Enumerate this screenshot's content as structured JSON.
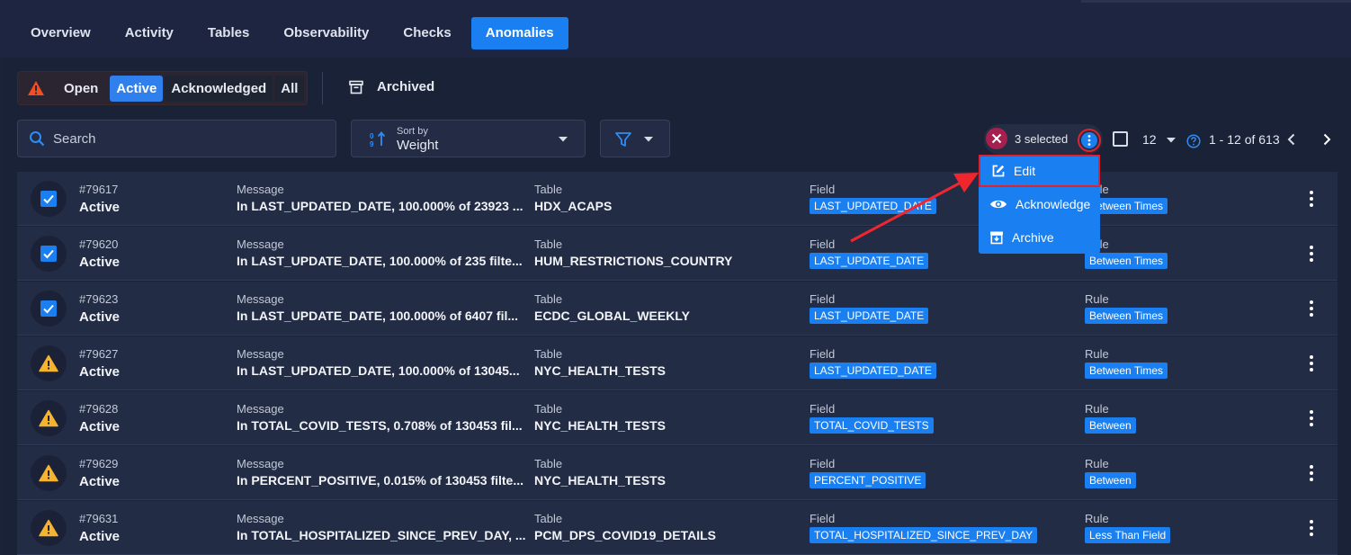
{
  "tabs": [
    "Overview",
    "Activity",
    "Tables",
    "Observability",
    "Checks",
    "Anomalies"
  ],
  "active_tab": "Anomalies",
  "status_filter": {
    "open": "Open",
    "active": "Active",
    "acknowledged": "Acknowledged",
    "all": "All"
  },
  "archived": "Archived",
  "search": {
    "placeholder": "Search"
  },
  "sort": {
    "label": "Sort by",
    "value": "Weight"
  },
  "selection": {
    "count_text": "3 selected"
  },
  "pagination": {
    "per_page": "12",
    "range": "1 - 12 of 613"
  },
  "menu": {
    "edit": "Edit",
    "acknowledge": "Acknowledge",
    "archive": "Archive"
  },
  "columns": {
    "message": "Message",
    "table": "Table",
    "field": "Field",
    "rule": "Rule"
  },
  "rows": [
    {
      "id": "#79617",
      "status": "Active",
      "message": "In LAST_UPDATED_DATE, 100.000% of 23923 ...",
      "table": "HDX_ACAPS",
      "field": "LAST_UPDATED_DATE",
      "rule": "Between Times",
      "selected": true
    },
    {
      "id": "#79620",
      "status": "Active",
      "message": "In LAST_UPDATE_DATE, 100.000% of 235 filte...",
      "table": "HUM_RESTRICTIONS_COUNTRY",
      "field": "LAST_UPDATE_DATE",
      "rule": "Between Times",
      "selected": true
    },
    {
      "id": "#79623",
      "status": "Active",
      "message": "In LAST_UPDATE_DATE, 100.000% of 6407 fil...",
      "table": "ECDC_GLOBAL_WEEKLY",
      "field": "LAST_UPDATE_DATE",
      "rule": "Between Times",
      "selected": true
    },
    {
      "id": "#79627",
      "status": "Active",
      "message": "In LAST_UPDATED_DATE, 100.000% of 13045...",
      "table": "NYC_HEALTH_TESTS",
      "field": "LAST_UPDATED_DATE",
      "rule": "Between Times",
      "selected": false
    },
    {
      "id": "#79628",
      "status": "Active",
      "message": "In TOTAL_COVID_TESTS, 0.708% of 130453 fil...",
      "table": "NYC_HEALTH_TESTS",
      "field": "TOTAL_COVID_TESTS",
      "rule": "Between",
      "selected": false
    },
    {
      "id": "#79629",
      "status": "Active",
      "message": "In PERCENT_POSITIVE, 0.015% of 130453 filte...",
      "table": "NYC_HEALTH_TESTS",
      "field": "PERCENT_POSITIVE",
      "rule": "Between",
      "selected": false
    },
    {
      "id": "#79631",
      "status": "Active",
      "message": "In TOTAL_HOSPITALIZED_SINCE_PREV_DAY, ...",
      "table": "PCM_DPS_COVID19_DETAILS",
      "field": "TOTAL_HOSPITALIZED_SINCE_PREV_DAY",
      "rule": "Less Than Field",
      "selected": false
    }
  ],
  "colors": {
    "accent": "#1a7ff0",
    "warning": "#f5b32e",
    "danger": "#e0222e",
    "bg": "#1b2338"
  }
}
